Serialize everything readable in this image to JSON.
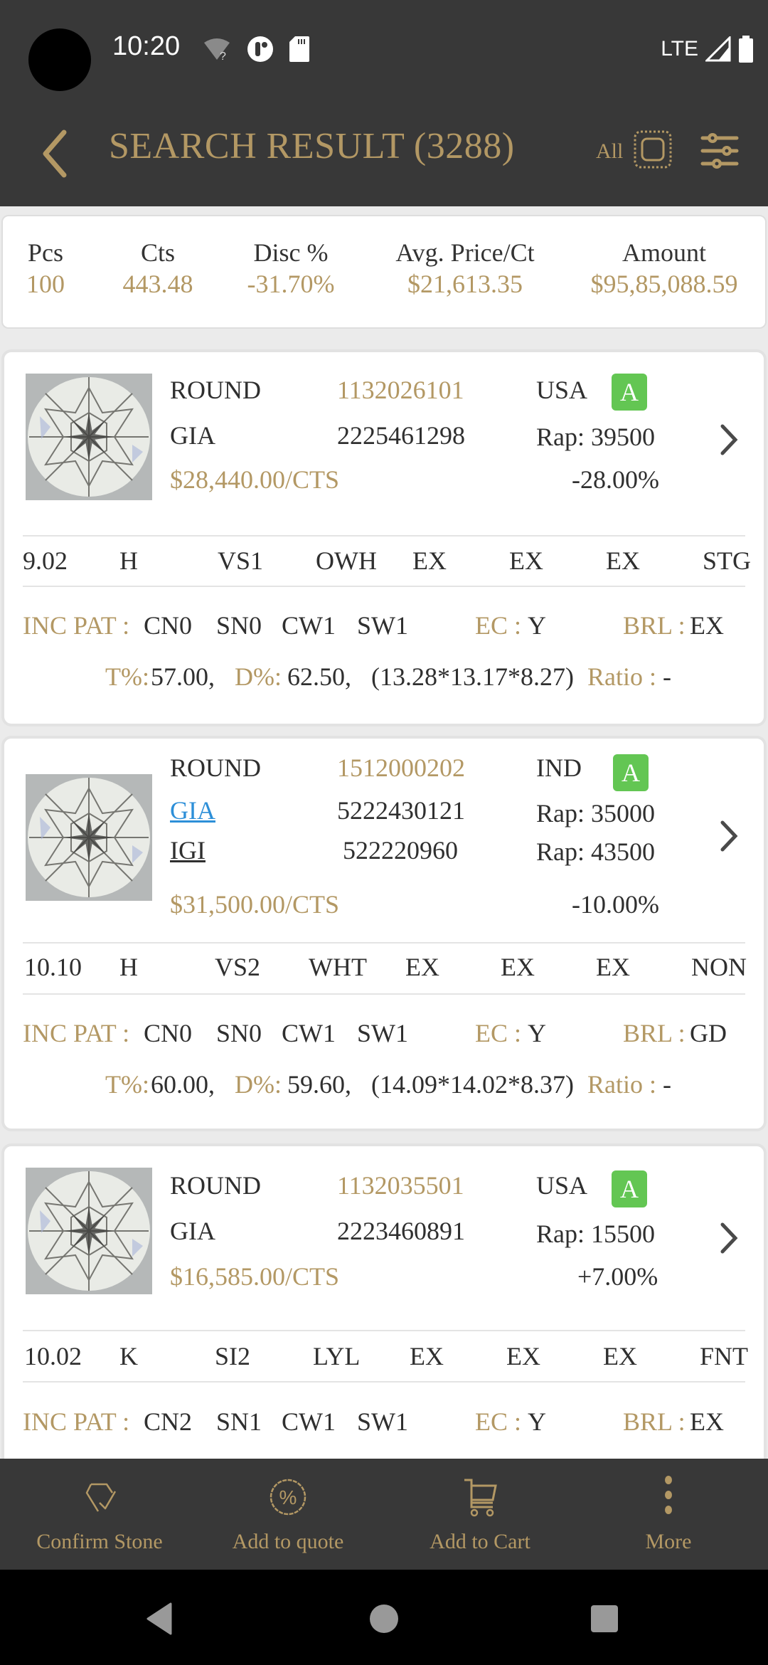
{
  "status_bar": {
    "time": "10:20",
    "network": "LTE",
    "icons": [
      "wifi-unknown-icon",
      "data-saver-icon",
      "sd-card-icon",
      "signal-icon",
      "battery-icon"
    ]
  },
  "header": {
    "title": "SEARCH RESULT (3288)",
    "all_label": "All",
    "icons": [
      "back-chevron-icon",
      "select-all-checkbox-icon",
      "filter-sliders-icon"
    ]
  },
  "summary": {
    "columns": [
      {
        "label": "Pcs",
        "value": "100"
      },
      {
        "label": "Cts",
        "value": "443.48"
      },
      {
        "label": "Disc %",
        "value": "-31.70%"
      },
      {
        "label": "Avg. Price/Ct",
        "value": "$21,613.35"
      },
      {
        "label": "Amount",
        "value": "$95,85,088.59"
      }
    ]
  },
  "stones": [
    {
      "shape": "ROUND",
      "stock_id": "1132026101",
      "location": "USA",
      "availability_badge": "A",
      "labs": [
        {
          "name": "GIA",
          "cert": "2225461298",
          "rap": "Rap: 39500",
          "style": "plain"
        }
      ],
      "price_per_ct": "$28,440.00/CTS",
      "discount": "-28.00%",
      "specs": [
        "9.02",
        "H",
        "VS1",
        "OWH",
        "EX",
        "EX",
        "EX",
        "STG"
      ],
      "inc_pat_label": "INC PAT :",
      "inc_pat": [
        "CN0",
        "SN0",
        "CW1",
        "SW1"
      ],
      "ec_label": "EC :",
      "ec": "Y",
      "brl_label": "BRL :",
      "brl": "EX",
      "t_label": "T%:",
      "t": "57.00,",
      "d_label": "D%:",
      "d": "62.50,",
      "measurements": "(13.28*13.17*8.27)",
      "ratio_label": "Ratio :",
      "ratio": "-"
    },
    {
      "shape": "ROUND",
      "stock_id": "1512000202",
      "location": "IND",
      "availability_badge": "A",
      "labs": [
        {
          "name": "GIA",
          "cert": "5222430121",
          "rap": "Rap: 35000",
          "style": "link-blue"
        },
        {
          "name": "IGI",
          "cert": "522220960",
          "rap": "Rap: 43500",
          "style": "link-dark"
        }
      ],
      "price_per_ct": "$31,500.00/CTS",
      "discount": "-10.00%",
      "specs": [
        "10.10",
        "H",
        "VS2",
        "WHT",
        "EX",
        "EX",
        "EX",
        "NON"
      ],
      "inc_pat_label": "INC PAT :",
      "inc_pat": [
        "CN0",
        "SN0",
        "CW1",
        "SW1"
      ],
      "ec_label": "EC :",
      "ec": "Y",
      "brl_label": "BRL :",
      "brl": "GD",
      "t_label": "T%:",
      "t": "60.00,",
      "d_label": "D%:",
      "d": "59.60,",
      "measurements": "(14.09*14.02*8.37)",
      "ratio_label": "Ratio :",
      "ratio": "-"
    },
    {
      "shape": "ROUND",
      "stock_id": "1132035501",
      "location": "USA",
      "availability_badge": "A",
      "labs": [
        {
          "name": "GIA",
          "cert": "2223460891",
          "rap": "Rap: 15500",
          "style": "plain"
        }
      ],
      "price_per_ct": "$16,585.00/CTS",
      "discount": "+7.00%",
      "specs": [
        "10.02",
        "K",
        "SI2",
        "LYL",
        "EX",
        "EX",
        "EX",
        "FNT"
      ],
      "inc_pat_label": "INC PAT :",
      "inc_pat": [
        "CN2",
        "SN1",
        "CW1",
        "SW1"
      ],
      "ec_label": "EC :",
      "ec": "Y",
      "brl_label": "BRL :",
      "brl": "EX"
    }
  ],
  "action_bar": {
    "items": [
      {
        "label": "Confirm Stone",
        "icon": "diamond-check-icon"
      },
      {
        "label": "Add to quote",
        "icon": "percent-badge-icon"
      },
      {
        "label": "Add to Cart",
        "icon": "cart-icon"
      },
      {
        "label": "More",
        "icon": "more-vertical-icon"
      }
    ]
  },
  "nav_bar": {
    "buttons": [
      "back-triangle-icon",
      "home-circle-icon",
      "recents-square-icon"
    ]
  },
  "colors": {
    "accent_gold": "#b39864",
    "header_bg": "#383838",
    "badge_green": "#63c653",
    "link_blue": "#2d8fd8",
    "text_dark": "#2f2f2f"
  }
}
